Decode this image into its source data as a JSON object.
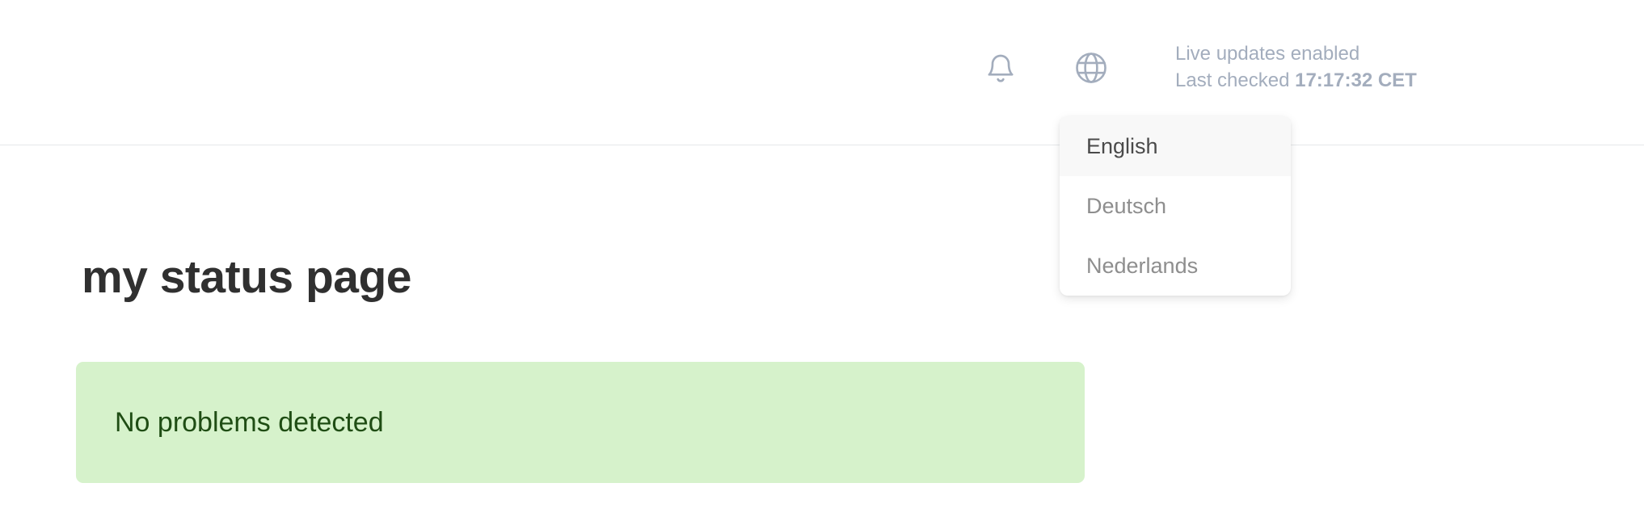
{
  "header": {
    "notifications_icon": "bell-icon",
    "language_icon": "globe-icon",
    "live_updates_text": "Live updates enabled",
    "last_checked_label": "Last checked",
    "last_checked_time": "17:17:32 CET",
    "icon_color": "#a3adbd"
  },
  "language_menu": {
    "items": [
      {
        "label": "English",
        "selected": true
      },
      {
        "label": "Deutsch",
        "selected": false
      },
      {
        "label": "Nederlands",
        "selected": false
      }
    ]
  },
  "main": {
    "title": "my status page",
    "status_banner": {
      "text": "No problems detected",
      "background_color": "#d6f2cb",
      "text_color": "#1f4d14"
    }
  }
}
